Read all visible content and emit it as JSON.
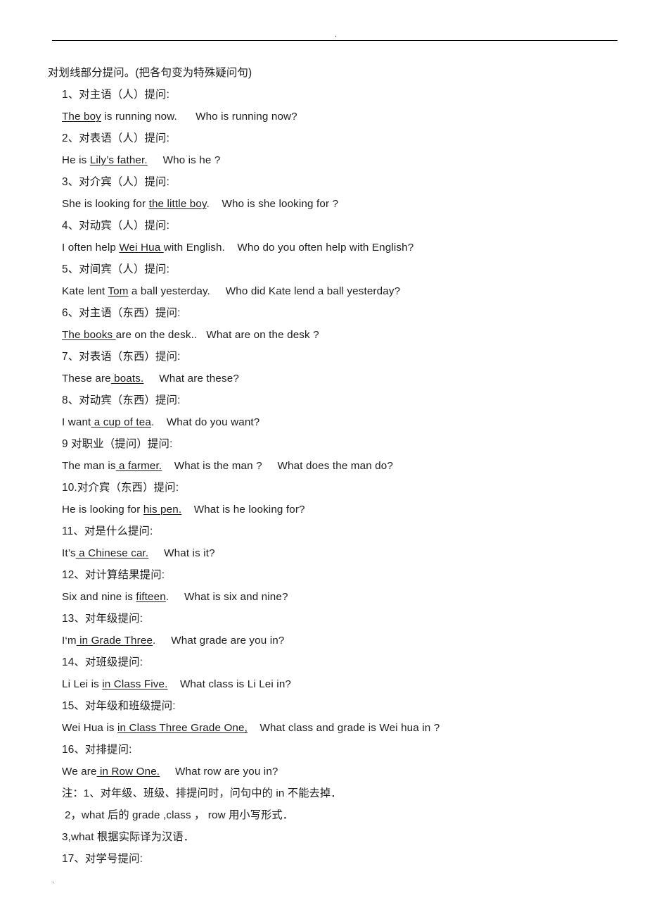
{
  "page": {
    "header_mark": ".",
    "footer_mark": "."
  },
  "document": {
    "title": "对划线部分提问。(把各句变为特殊疑问句)",
    "lines": [
      {
        "kind": "item",
        "text": "1、对主语（人）提问:"
      },
      {
        "kind": "sentence",
        "underlined": "The boy",
        "pre": "",
        "post": " is running now.      Who is running now?"
      },
      {
        "kind": "item",
        "text": "2、对表语（人）提问:"
      },
      {
        "kind": "sentence",
        "underlined": "Lily’s father.",
        "pre": "He is ",
        "post": "     Who is he ?"
      },
      {
        "kind": "item",
        "text": "3、对介宾（人）提问:"
      },
      {
        "kind": "sentence",
        "underlined": "the little boy",
        "pre": "She is looking for ",
        "post": ".    Who is she looking for ?"
      },
      {
        "kind": "item",
        "text": "4、对动宾（人）提问:"
      },
      {
        "kind": "sentence",
        "underlined": "Wei Hua ",
        "pre": "I often help ",
        "post": "with English.    Who do you often help with English?"
      },
      {
        "kind": "item",
        "text": "5、对间宾（人）提问:"
      },
      {
        "kind": "sentence",
        "underlined": "Tom",
        "pre": "Kate lent ",
        "post": " a ball yesterday.     Who did Kate lend a ball yesterday?"
      },
      {
        "kind": "item",
        "text": "6、对主语（东西）提问:"
      },
      {
        "kind": "sentence",
        "underlined": "The books ",
        "pre": "",
        "post": "are on the desk..   What are on the desk ?"
      },
      {
        "kind": "item",
        "text": "7、对表语（东西）提问:"
      },
      {
        "kind": "sentence",
        "underlined": " boats.",
        "pre": "These are",
        "post": "     What are these?"
      },
      {
        "kind": "item",
        "text": "8、对动宾（东西）提问:"
      },
      {
        "kind": "sentence",
        "underlined": " a cup of tea",
        "pre": "I want",
        "post": ".    What do you want?"
      },
      {
        "kind": "item",
        "text": "9 对职业（提问）提问:"
      },
      {
        "kind": "sentence",
        "underlined": " a farmer.",
        "pre": "The man is",
        "post": "    What is the man ?     What does the man do?"
      },
      {
        "kind": "item",
        "text": "10.对介宾（东西）提问:"
      },
      {
        "kind": "sentence",
        "underlined": "his pen.",
        "pre": "He is looking for ",
        "post": "    What is he looking for?"
      },
      {
        "kind": "item",
        "text": "11、对是什么提问:"
      },
      {
        "kind": "sentence",
        "underlined": " a Chinese car.",
        "pre": "It’s",
        "post": "     What is it?"
      },
      {
        "kind": "item",
        "text": "12、对计算结果提问:"
      },
      {
        "kind": "sentence",
        "underlined": "fifteen",
        "pre": "Six and nine is ",
        "post": ".     What is six and nine?"
      },
      {
        "kind": "item",
        "text": "13、对年级提问:"
      },
      {
        "kind": "sentence",
        "underlined": " in Grade Three",
        "pre": "I‘m",
        "post": ".     What grade are you in?"
      },
      {
        "kind": "item",
        "text": "14、对班级提问:"
      },
      {
        "kind": "sentence",
        "underlined": "in Class Five.",
        "pre": "Li Lei is ",
        "post": "    What class is Li Lei in?"
      },
      {
        "kind": "item",
        "text": "15、对年级和班级提问:"
      },
      {
        "kind": "sentence",
        "underlined": "in Class Three Grade One,",
        "pre": "Wei Hua is ",
        "post": "    What class and grade is Wei hua in ?"
      },
      {
        "kind": "item",
        "text": "16、对排提问:"
      },
      {
        "kind": "sentence",
        "underlined": " in Row One.",
        "pre": "We are",
        "post": "     What row are you in?"
      },
      {
        "kind": "note",
        "text": "注：1、对年级、班级、排提问时，问句中的 in 不能去掉．"
      },
      {
        "kind": "note2",
        "text": "2，what 后的 grade ,class ， row 用小写形式．"
      },
      {
        "kind": "note3",
        "text": "3,what 根据实际译为汉语．"
      },
      {
        "kind": "item",
        "text": "17、对学号提问:"
      }
    ]
  }
}
